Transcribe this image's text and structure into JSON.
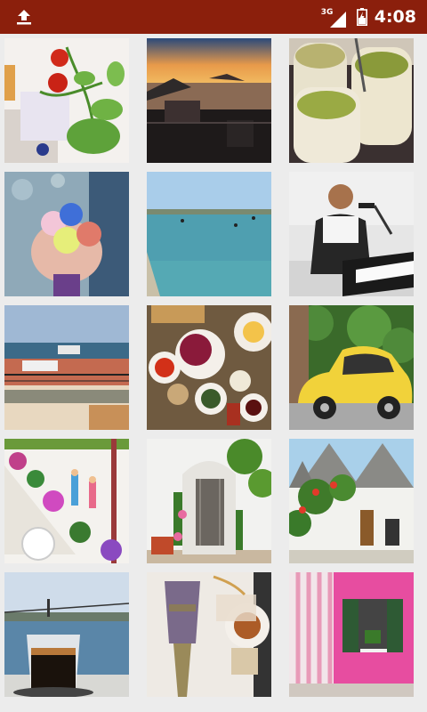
{
  "status_bar": {
    "network": "3G",
    "time": "4:08",
    "icons": [
      "upload-icon",
      "signal-icon",
      "battery-icon"
    ]
  },
  "gallery": {
    "photos": [
      {
        "name": "photo-tomato-plant"
      },
      {
        "name": "photo-sunset-balcony"
      },
      {
        "name": "photo-lemonade-drinks"
      },
      {
        "name": "photo-macarons-hand"
      },
      {
        "name": "photo-sea-swimmers"
      },
      {
        "name": "photo-piano-singer"
      },
      {
        "name": "photo-seaside-cafe"
      },
      {
        "name": "photo-breakfast-table"
      },
      {
        "name": "photo-yellow-fiat"
      },
      {
        "name": "photo-flower-stairs"
      },
      {
        "name": "photo-white-doorway"
      },
      {
        "name": "photo-trulli-houses"
      },
      {
        "name": "photo-coffee-bosphorus"
      },
      {
        "name": "photo-lavender-tea"
      },
      {
        "name": "photo-pink-window"
      }
    ]
  },
  "colors": {
    "status_bar_bg": "#8b1f0c",
    "grid_bg": "#ececec"
  }
}
